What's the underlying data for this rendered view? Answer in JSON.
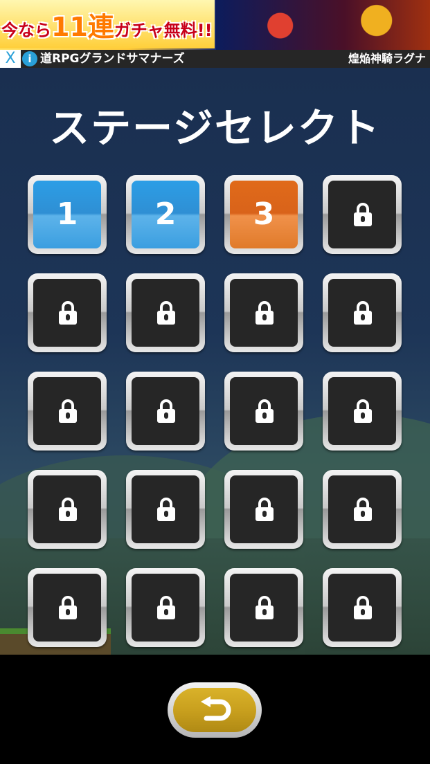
{
  "ad": {
    "promo_prefix": "今なら",
    "promo_count": "11連",
    "promo_suffix": "ガチャ無料!!",
    "close": "X",
    "info": "i",
    "game_name": "道RPGグランドサマナーズ",
    "hero_name": "煌焔神騎ラグナ"
  },
  "title": "ステージセレクト",
  "stages": [
    {
      "label": "1",
      "state": "unlocked",
      "color": "#2c9ee6"
    },
    {
      "label": "2",
      "state": "unlocked",
      "color": "#2c9ee6"
    },
    {
      "label": "3",
      "state": "current",
      "color": "#e06a1a"
    },
    {
      "label": "",
      "state": "locked"
    },
    {
      "label": "",
      "state": "locked"
    },
    {
      "label": "",
      "state": "locked"
    },
    {
      "label": "",
      "state": "locked"
    },
    {
      "label": "",
      "state": "locked"
    },
    {
      "label": "",
      "state": "locked"
    },
    {
      "label": "",
      "state": "locked"
    },
    {
      "label": "",
      "state": "locked"
    },
    {
      "label": "",
      "state": "locked"
    },
    {
      "label": "",
      "state": "locked"
    },
    {
      "label": "",
      "state": "locked"
    },
    {
      "label": "",
      "state": "locked"
    },
    {
      "label": "",
      "state": "locked"
    },
    {
      "label": "",
      "state": "locked"
    },
    {
      "label": "",
      "state": "locked"
    },
    {
      "label": "",
      "state": "locked"
    },
    {
      "label": "",
      "state": "locked"
    }
  ],
  "icons": {
    "lock": "lock-icon",
    "back": "back-arrow-icon"
  },
  "colors": {
    "background": "#1d3557",
    "tile_locked": "#262626",
    "back_button": "#c9a01e"
  }
}
